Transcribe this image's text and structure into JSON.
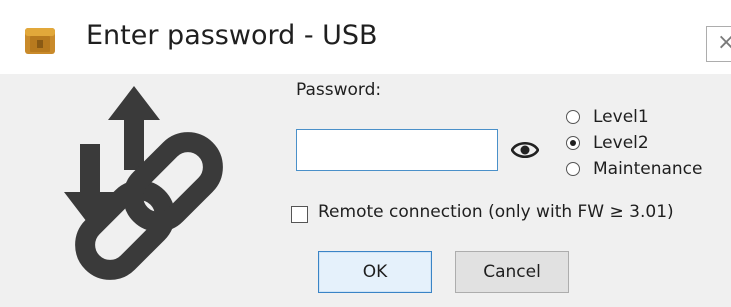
{
  "window": {
    "title": "Enter password - USB",
    "close_glyph": "×"
  },
  "icons": {
    "app": "folder-key-icon",
    "link": "link-transfer-icon",
    "eye": "eye-icon"
  },
  "form": {
    "password_label": "Password:",
    "password_value": "",
    "levels": [
      {
        "label": "Level1",
        "selected": false
      },
      {
        "label": "Level2",
        "selected": true
      },
      {
        "label": "Maintenance",
        "selected": false
      }
    ],
    "remote_label": "Remote connection (only with FW ≥ 3.01)",
    "remote_checked": false
  },
  "buttons": {
    "ok": "OK",
    "cancel": "Cancel"
  },
  "colors": {
    "accent": "#3a84c6",
    "icon_dark": "#3a3a3a"
  }
}
